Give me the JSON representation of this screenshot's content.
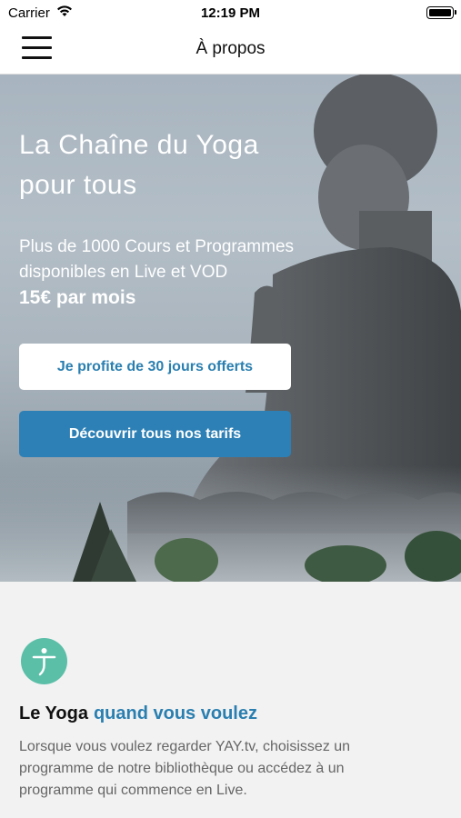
{
  "status_bar": {
    "carrier": "Carrier",
    "time": "12:19 PM"
  },
  "nav": {
    "title": "À propos",
    "menu_icon": "hamburger-icon"
  },
  "hero": {
    "title": "La Chaîne du Yoga pour tous",
    "subtitle": "Plus de 1000 Cours et Programmes disponibles en Live et VOD",
    "price": "15€ par mois",
    "trial_button": "Je profite de 30 jours offerts",
    "tarifs_button": "Découvrir tous nos tarifs"
  },
  "feature": {
    "icon": "yoga-icon",
    "title_main": "Le Yoga",
    "title_accent": "quand vous voulez",
    "description": "Lorsque vous voulez regarder YAY.tv, choisissez un programme de notre bibliothèque ou accédez à un programme qui commence en Live."
  },
  "colors": {
    "accent": "#2a7fb0",
    "button_primary": "#2d80b5",
    "icon_teal": "#5bbfa8"
  }
}
